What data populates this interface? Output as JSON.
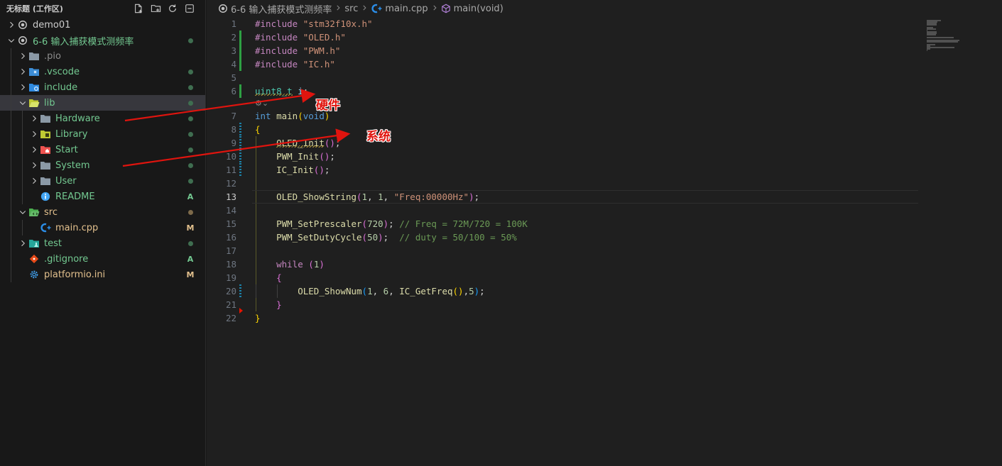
{
  "sidebar": {
    "workspace_title": "无标题 (工作区)",
    "actions": [
      {
        "icon": "new-file-icon"
      },
      {
        "icon": "new-folder-icon"
      },
      {
        "icon": "refresh-icon"
      },
      {
        "icon": "collapse-all-icon"
      }
    ],
    "tree": [
      {
        "label": "demo01",
        "depth": 0,
        "chevron": "right",
        "icon": "project-root-icon",
        "labelColor": "#cccccc",
        "badge": ""
      },
      {
        "label": "6-6 输入捕获模式测频率",
        "depth": 0,
        "chevron": "down",
        "icon": "project-root-icon",
        "labelColor": "#73c991",
        "badge": "dot",
        "badgeColor": "#3f6e50"
      },
      {
        "label": ".pio",
        "depth": 1,
        "chevron": "right",
        "icon": "folder-icon",
        "labelColor": "#8c8c8c",
        "badge": ""
      },
      {
        "label": ".vscode",
        "depth": 1,
        "chevron": "right",
        "icon": "vscode-folder-icon",
        "labelColor": "#73c991",
        "badge": "dot",
        "badgeColor": "#3f6e50"
      },
      {
        "label": "include",
        "depth": 1,
        "chevron": "right",
        "icon": "include-folder-icon",
        "labelColor": "#73c991",
        "badge": "dot",
        "badgeColor": "#3f6e50"
      },
      {
        "label": "lib",
        "depth": 1,
        "chevron": "down",
        "icon": "lib-folder-open-icon",
        "labelColor": "#73c991",
        "badge": "dot",
        "badgeColor": "#3f6e50",
        "selected": true
      },
      {
        "label": "Hardware",
        "depth": 2,
        "chevron": "right",
        "icon": "folder-icon",
        "labelColor": "#73c991",
        "badge": "dot",
        "badgeColor": "#3f6e50"
      },
      {
        "label": "Library",
        "depth": 2,
        "chevron": "right",
        "icon": "library-folder-icon",
        "labelColor": "#73c991",
        "badge": "dot",
        "badgeColor": "#3f6e50"
      },
      {
        "label": "Start",
        "depth": 2,
        "chevron": "right",
        "icon": "home-folder-icon",
        "labelColor": "#73c991",
        "badge": "dot",
        "badgeColor": "#3f6e50"
      },
      {
        "label": "System",
        "depth": 2,
        "chevron": "right",
        "icon": "folder-icon",
        "labelColor": "#73c991",
        "badge": "dot",
        "badgeColor": "#3f6e50"
      },
      {
        "label": "User",
        "depth": 2,
        "chevron": "right",
        "icon": "folder-icon",
        "labelColor": "#73c991",
        "badge": "dot",
        "badgeColor": "#3f6e50"
      },
      {
        "label": "README",
        "depth": 2,
        "chevron": "",
        "icon": "info-icon",
        "labelColor": "#73c991",
        "badge": "A",
        "badgeColor": "#73c991"
      },
      {
        "label": "src",
        "depth": 1,
        "chevron": "down",
        "icon": "src-folder-open-icon",
        "labelColor": "#e2c08d",
        "badge": "dot",
        "badgeColor": "#7d6a4a"
      },
      {
        "label": "main.cpp",
        "depth": 2,
        "chevron": "",
        "icon": "cpp-file-icon",
        "labelColor": "#e2c08d",
        "badge": "M",
        "badgeColor": "#e2c08d"
      },
      {
        "label": "test",
        "depth": 1,
        "chevron": "right",
        "icon": "test-folder-icon",
        "labelColor": "#73c991",
        "badge": "dot",
        "badgeColor": "#3f6e50"
      },
      {
        "label": ".gitignore",
        "depth": 1,
        "chevron": "",
        "icon": "git-icon",
        "labelColor": "#73c991",
        "badge": "A",
        "badgeColor": "#73c991"
      },
      {
        "label": "platformio.ini",
        "depth": 1,
        "chevron": "",
        "icon": "settings-gear-icon",
        "labelColor": "#e2c08d",
        "badge": "M",
        "badgeColor": "#e2c08d"
      }
    ]
  },
  "breadcrumb": {
    "items": [
      {
        "label": "6-6 输入捕获模式测频率",
        "icon": "project-root-icon"
      },
      {
        "label": "src",
        "icon": ""
      },
      {
        "label": "main.cpp",
        "icon": "cpp-file-icon"
      },
      {
        "label": "main(void)",
        "icon": "method-cube-icon"
      }
    ]
  },
  "editor": {
    "current_line": 13,
    "codelens_after_line": 6,
    "lines": [
      {
        "n": "1",
        "gutter": "",
        "tokens": [
          [
            "#include ",
            "t-pre"
          ],
          [
            "\"stm32f10x.h\"",
            "t-str"
          ]
        ]
      },
      {
        "n": "2",
        "gutter": "added",
        "tokens": [
          [
            "#include ",
            "t-pre"
          ],
          [
            "\"OLED.h\"",
            "t-str"
          ]
        ]
      },
      {
        "n": "3",
        "gutter": "added",
        "tokens": [
          [
            "#include ",
            "t-pre"
          ],
          [
            "\"PWM.h\"",
            "t-str"
          ]
        ]
      },
      {
        "n": "4",
        "gutter": "added",
        "tokens": [
          [
            "#include ",
            "t-pre"
          ],
          [
            "\"IC.h\"",
            "t-str"
          ]
        ]
      },
      {
        "n": "5",
        "gutter": "",
        "tokens": []
      },
      {
        "n": "6",
        "gutter": "added",
        "tokens": [
          [
            "uint8_t",
            "t-type squig"
          ],
          [
            " ",
            "t-plain"
          ],
          [
            "i",
            "t-var"
          ],
          [
            ";",
            "t-plain"
          ]
        ]
      },
      {
        "n": "7",
        "gutter": "",
        "tokens": [
          [
            "int",
            "t-kw"
          ],
          [
            " ",
            "t-plain"
          ],
          [
            "main",
            "t-fn"
          ],
          [
            "(",
            "b1"
          ],
          [
            "void",
            "t-kw"
          ],
          [
            ")",
            "b1"
          ]
        ]
      },
      {
        "n": "8",
        "gutter": "modified",
        "tokens": [
          [
            "{",
            "b1"
          ]
        ]
      },
      {
        "n": "9",
        "gutter": "modified",
        "indent": 1,
        "tokens": [
          [
            "    ",
            "t-plain"
          ],
          [
            "OLED_Init",
            "t-fn squig"
          ],
          [
            "(",
            "b2"
          ],
          [
            ")",
            "b2"
          ],
          [
            ";",
            "t-plain"
          ]
        ]
      },
      {
        "n": "10",
        "gutter": "modified",
        "indent": 1,
        "tokens": [
          [
            "    ",
            "t-plain"
          ],
          [
            "PWM_Init",
            "t-fn"
          ],
          [
            "(",
            "b2"
          ],
          [
            ")",
            "b2"
          ],
          [
            ";",
            "t-plain"
          ]
        ]
      },
      {
        "n": "11",
        "gutter": "modified",
        "indent": 1,
        "tokens": [
          [
            "    ",
            "t-plain"
          ],
          [
            "IC_Init",
            "t-fn"
          ],
          [
            "(",
            "b2"
          ],
          [
            ")",
            "b2"
          ],
          [
            ";",
            "t-plain"
          ]
        ]
      },
      {
        "n": "12",
        "gutter": "",
        "indent": 1,
        "tokens": []
      },
      {
        "n": "13",
        "gutter": "",
        "indent": 1,
        "tokens": [
          [
            "    ",
            "t-plain"
          ],
          [
            "OLED_ShowString",
            "t-fn"
          ],
          [
            "(",
            "b2"
          ],
          [
            "1",
            "t-num"
          ],
          [
            ", ",
            "t-plain"
          ],
          [
            "1",
            "t-num"
          ],
          [
            ", ",
            "t-plain"
          ],
          [
            "\"Freq:00000Hz\"",
            "t-str"
          ],
          [
            ")",
            "b2"
          ],
          [
            ";",
            "t-plain"
          ]
        ]
      },
      {
        "n": "14",
        "gutter": "",
        "indent": 1,
        "tokens": []
      },
      {
        "n": "15",
        "gutter": "",
        "indent": 1,
        "tokens": [
          [
            "    ",
            "t-plain"
          ],
          [
            "PWM_SetPrescaler",
            "t-fn"
          ],
          [
            "(",
            "b2"
          ],
          [
            "720",
            "t-num"
          ],
          [
            ")",
            "b2"
          ],
          [
            ";",
            "t-plain"
          ],
          [
            " ",
            "t-plain"
          ],
          [
            "// Freq = 72M/720 = 100K",
            "t-com"
          ]
        ]
      },
      {
        "n": "16",
        "gutter": "",
        "indent": 1,
        "tokens": [
          [
            "    ",
            "t-plain"
          ],
          [
            "PWM_SetDutyCycle",
            "t-fn"
          ],
          [
            "(",
            "b2"
          ],
          [
            "50",
            "t-num"
          ],
          [
            ")",
            "b2"
          ],
          [
            ";",
            "t-plain"
          ],
          [
            "  ",
            "t-plain"
          ],
          [
            "// duty = 50/100 = 50%",
            "t-com"
          ]
        ]
      },
      {
        "n": "17",
        "gutter": "",
        "indent": 1,
        "tokens": []
      },
      {
        "n": "18",
        "gutter": "",
        "indent": 1,
        "tokens": [
          [
            "    ",
            "t-plain"
          ],
          [
            "while",
            "t-ctrl"
          ],
          [
            " ",
            "t-plain"
          ],
          [
            "(",
            "b2"
          ],
          [
            "1",
            "t-num"
          ],
          [
            ")",
            "b2"
          ]
        ]
      },
      {
        "n": "19",
        "gutter": "",
        "indent": 1,
        "tokens": [
          [
            "    ",
            "t-plain"
          ],
          [
            "{",
            "b2"
          ]
        ]
      },
      {
        "n": "20",
        "gutter": "modified",
        "indent": 2,
        "tokens": [
          [
            "        ",
            "t-plain"
          ],
          [
            "OLED_ShowNum",
            "t-fn"
          ],
          [
            "(",
            "b3"
          ],
          [
            "1",
            "t-num"
          ],
          [
            ", ",
            "t-plain"
          ],
          [
            "6",
            "t-num"
          ],
          [
            ", ",
            "t-plain"
          ],
          [
            "IC_GetFreq",
            "t-fn"
          ],
          [
            "(",
            "b1"
          ],
          [
            ")",
            "b1"
          ],
          [
            ",",
            "t-plain"
          ],
          [
            "5",
            "t-num"
          ],
          [
            ")",
            "b3"
          ],
          [
            ";",
            "t-plain"
          ]
        ]
      },
      {
        "n": "21",
        "gutter": "deleted",
        "indent": 1,
        "tokens": [
          [
            "    ",
            "t-plain"
          ],
          [
            "}",
            "b2"
          ]
        ]
      },
      {
        "n": "22",
        "gutter": "",
        "tokens": [
          [
            "}",
            "b1"
          ]
        ]
      }
    ]
  },
  "annotations": [
    {
      "label": "硬件",
      "color": "#e0140e"
    },
    {
      "label": "系统",
      "color": "#e0140e"
    }
  ]
}
